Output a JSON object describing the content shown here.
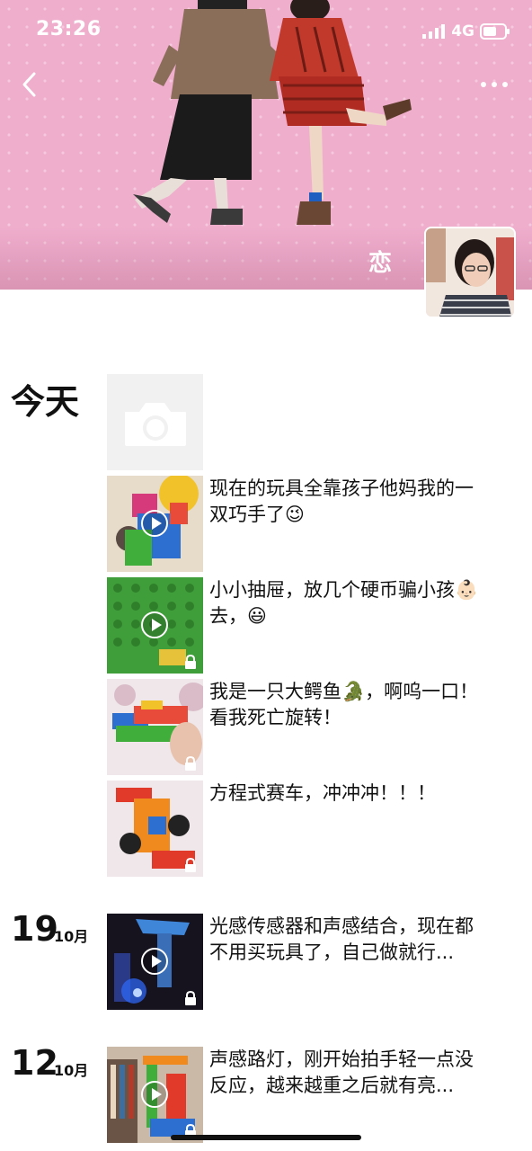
{
  "status_bar": {
    "time": "23:26",
    "network": "4G"
  },
  "cover": {
    "nickname": "恋"
  },
  "feed": {
    "today_label": "今天",
    "today_posts": [
      {
        "caption": "现在的玩具全靠孩子他妈我的一双巧手了😉",
        "video": true,
        "locked": false
      },
      {
        "caption": "小小抽屉，放几个硬币骗小孩👶🏻去，😃",
        "video": true,
        "locked": true
      },
      {
        "caption": "我是一只大鳄鱼🐊，啊呜一口！看我死亡旋转！",
        "video": false,
        "locked": true
      },
      {
        "caption": "方程式赛车，冲冲冲！！！",
        "video": false,
        "locked": true
      }
    ],
    "dated_groups": [
      {
        "day": "19",
        "month": "10月",
        "caption": "光感传感器和声感结合，现在都不用买玩具了，自己做就行...",
        "video": true,
        "locked": true
      },
      {
        "day": "12",
        "month": "10月",
        "caption": "声感路灯，刚开始拍手轻一点没反应，越来越重之后就有亮...",
        "video": true,
        "locked": true
      }
    ]
  }
}
